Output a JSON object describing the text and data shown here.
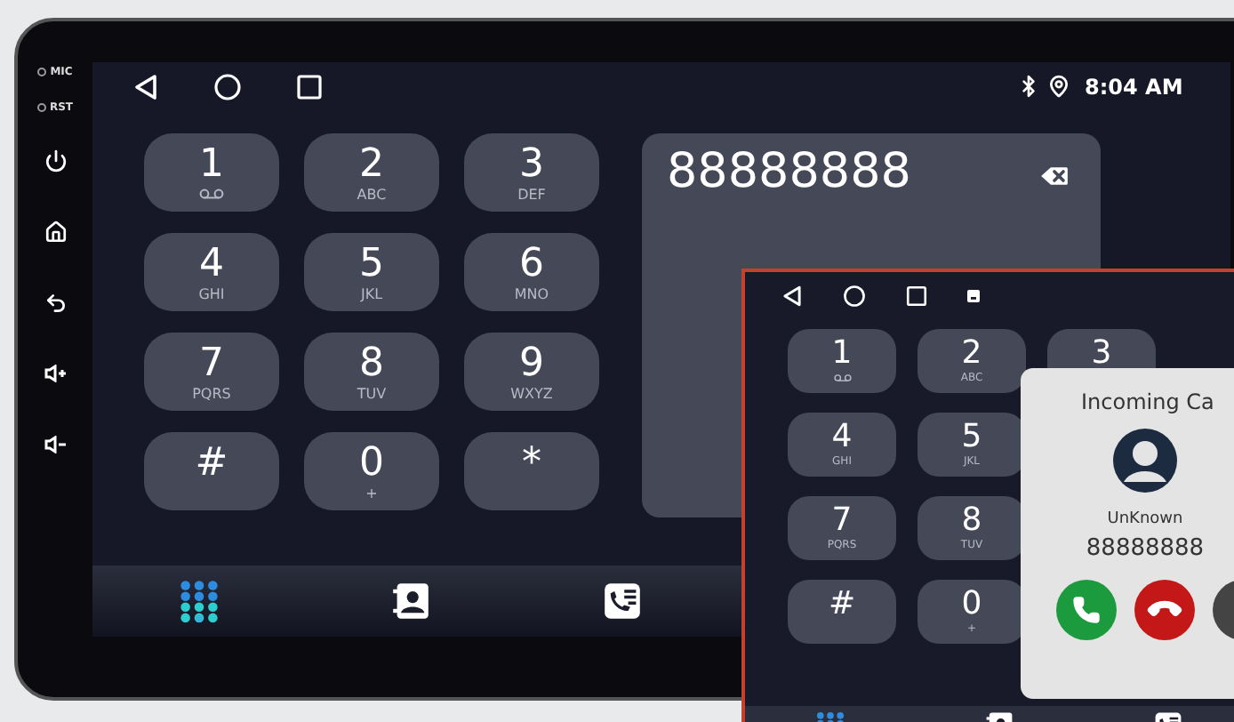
{
  "bezel": {
    "labels": [
      "MIC",
      "RST"
    ],
    "buttons": [
      {
        "kind": "power"
      },
      {
        "kind": "home"
      },
      {
        "kind": "back"
      },
      {
        "kind": "volume_up"
      },
      {
        "kind": "volume_down"
      }
    ]
  },
  "status_bar": {
    "time": "8:04 AM"
  },
  "keypad": [
    {
      "digit": "1",
      "kind": "voicemail"
    },
    {
      "digit": "2",
      "kind": "letters",
      "letters": "ABC"
    },
    {
      "digit": "3",
      "kind": "letters",
      "letters": "DEF"
    },
    {
      "digit": "4",
      "kind": "letters",
      "letters": "GHI"
    },
    {
      "digit": "5",
      "kind": "letters",
      "letters": "JKL"
    },
    {
      "digit": "6",
      "kind": "letters",
      "letters": "MNO"
    },
    {
      "digit": "7",
      "kind": "letters",
      "letters": "PQRS"
    },
    {
      "digit": "8",
      "kind": "letters",
      "letters": "TUV"
    },
    {
      "digit": "9",
      "kind": "letters",
      "letters": "WXYZ"
    },
    {
      "digit": "#",
      "kind": "symbol"
    },
    {
      "digit": "0",
      "kind": "letters",
      "letters": "+"
    },
    {
      "digit": "*",
      "kind": "symbol"
    }
  ],
  "display": {
    "number": "88888888"
  },
  "nav_tabs": [
    {
      "kind": "dialpad",
      "selected": true
    },
    {
      "kind": "contacts",
      "selected": false
    },
    {
      "kind": "call_log",
      "selected": false
    }
  ],
  "inset": {
    "keypad_rows": [
      [
        {
          "digit": "1",
          "kind": "voicemail"
        },
        {
          "digit": "2",
          "kind": "letters",
          "letters": "ABC"
        },
        {
          "digit": "3",
          "kind": "symbol"
        }
      ],
      [
        {
          "digit": "4",
          "kind": "letters",
          "letters": "GHI"
        },
        {
          "digit": "5",
          "kind": "letters",
          "letters": "JKL"
        }
      ],
      [
        {
          "digit": "7",
          "kind": "letters",
          "letters": "PQRS"
        },
        {
          "digit": "8",
          "kind": "letters",
          "letters": "TUV"
        }
      ],
      [
        {
          "digit": "#",
          "kind": "symbol"
        },
        {
          "digit": "0",
          "kind": "letters",
          "letters": "+"
        }
      ]
    ],
    "nav_tabs": [
      {
        "kind": "dialpad",
        "selected": true
      },
      {
        "kind": "contacts",
        "selected": false
      },
      {
        "kind": "call_log",
        "selected": false
      }
    ],
    "call": {
      "title": "Incoming Ca",
      "name": "UnKnown",
      "number": "88888888"
    }
  }
}
